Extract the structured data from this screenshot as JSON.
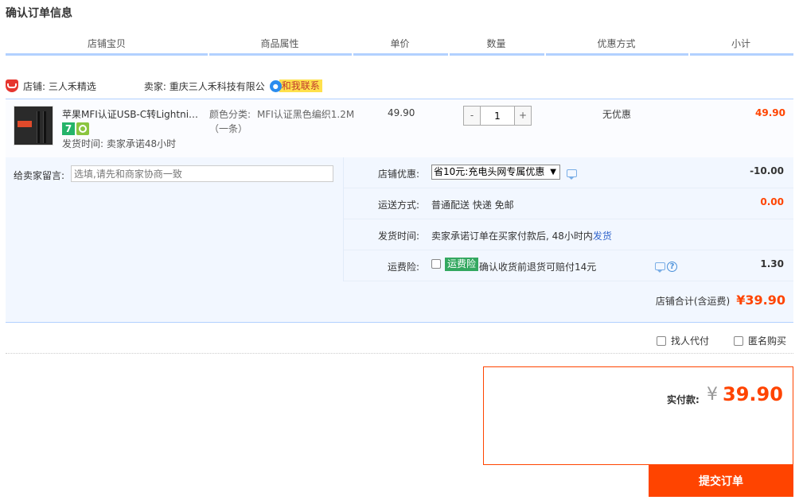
{
  "page": {
    "title": "确认订单信息"
  },
  "columns": [
    "店铺宝贝",
    "商品属性",
    "单价",
    "数量",
    "优惠方式",
    "小计"
  ],
  "shop": {
    "shop_label": "店铺: 三人禾精选",
    "seller_label": "卖家: 重庆三人禾科技有限公",
    "contact_label": "和我联系"
  },
  "item": {
    "name": "苹果MFI认证USB-C转Lightning...",
    "badge_text": "7",
    "ship_time": "发货时间:  卖家承诺48小时",
    "attr_label": "颜色分类:",
    "attr_value": "MFI认证黑色编织1.2M",
    "attr_value2": "（一条）",
    "unit_price": "49.90",
    "quantity": "1",
    "qty_minus": "-",
    "qty_plus": "+",
    "discount": "无优惠",
    "subtotal": "49.90"
  },
  "memo": {
    "label": "给卖家留言:",
    "placeholder": "选填,请先和商家协商一致"
  },
  "options": {
    "coupon": {
      "label": "店铺优惠:",
      "value": "省10元:充电头网专属优惠",
      "amount": "-10.00"
    },
    "shipping": {
      "label": "运送方式:",
      "value": "普通配送 快递 免邮",
      "amount": "0.00"
    },
    "delivery": {
      "label": "发货时间:",
      "value": "卖家承诺订单在买家付款后, 48小时内",
      "link": "发货"
    },
    "insurance": {
      "label": "运费险:",
      "tag": "运费险",
      "value": "确认收货前退货可赔付14元",
      "amount": "1.30"
    }
  },
  "shop_total": {
    "label": "店铺合计(含运费)",
    "amount": "¥39.90"
  },
  "extras": {
    "proxy_pay": "找人代付",
    "anonymous": "匿名购买"
  },
  "payment": {
    "label": "实付款:",
    "yen": "¥",
    "amount": "39.90",
    "submit": "提交订单"
  },
  "colors": {
    "accent": "#ff4400",
    "table_border": "#b2d1ff",
    "option_bg": "#f2f7ff"
  }
}
